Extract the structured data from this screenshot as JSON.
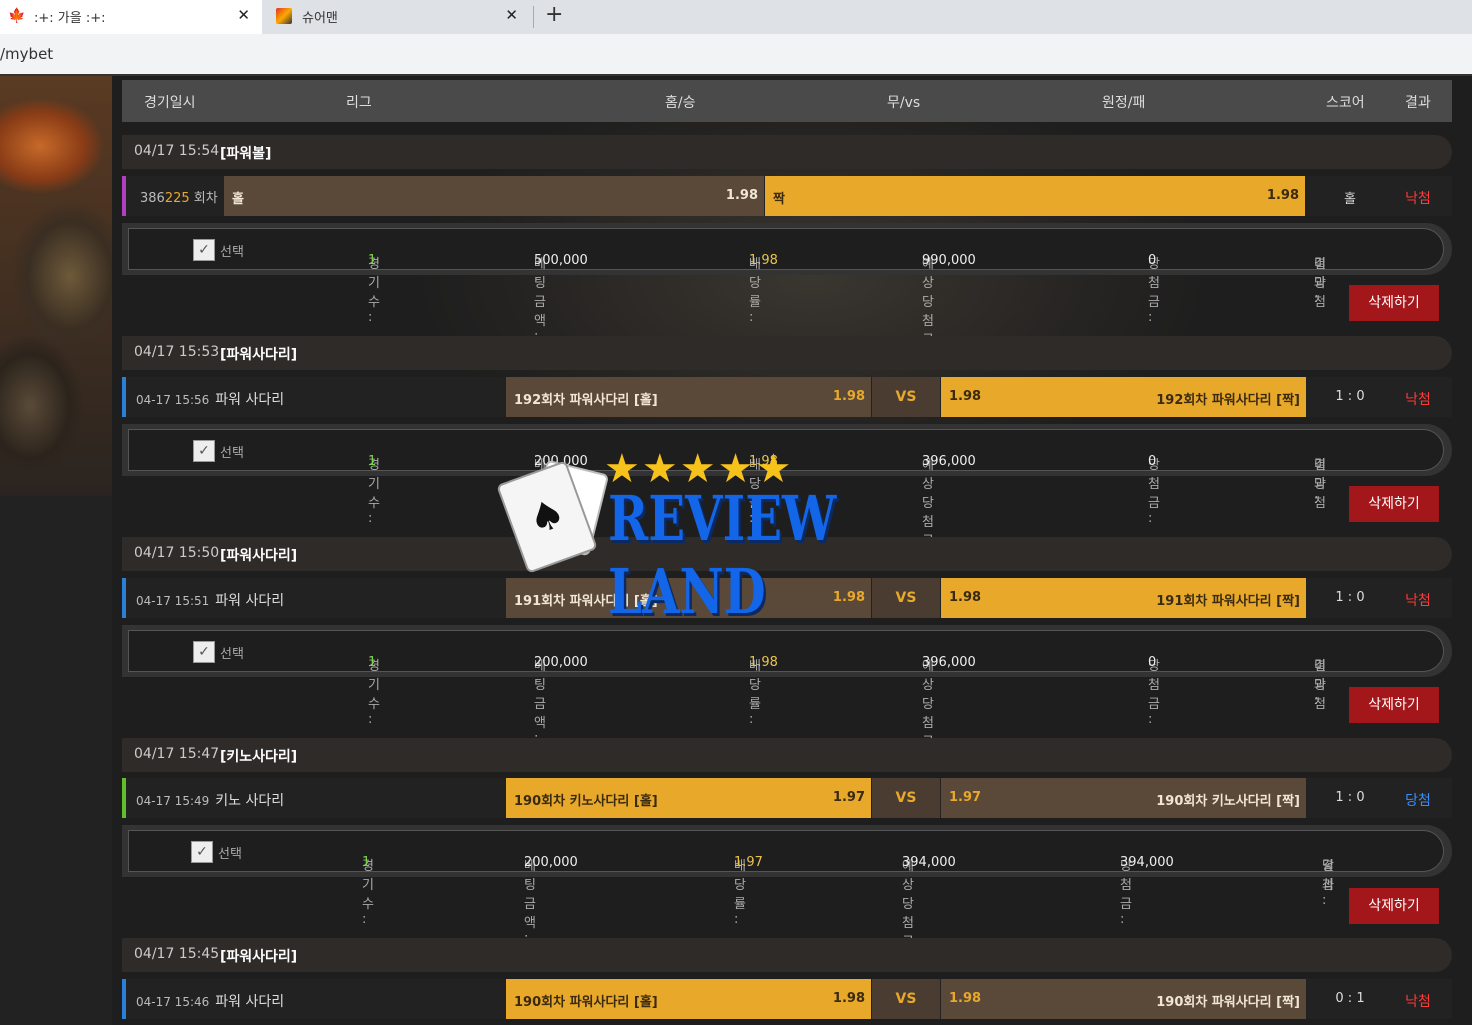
{
  "browser": {
    "tabs": [
      {
        "title": ":+: 가을 :+:",
        "favicon": "maple-leaf-icon"
      },
      {
        "title": "슈어맨",
        "favicon": "site-favicon"
      }
    ],
    "new_tab_label": "+",
    "close_label": "✕",
    "url": "/mybet"
  },
  "header": {
    "date": "경기일시",
    "league": "리그",
    "home": "홈/승",
    "draw": "무/vs",
    "away": "원정/패",
    "score": "스코어",
    "result": "결과"
  },
  "watermark": {
    "text": "REVIEW LAND",
    "stars": "★★★★★"
  },
  "labels": {
    "select": "선택",
    "count": "경기수 : ",
    "bet_amount": "베팅금액 : ",
    "odds": "배당률 : ",
    "expected": "예상당첨금 : ",
    "won": "당첨금 : ",
    "result": "결과 : ",
    "delete": "삭제하기",
    "vs": "VS"
  },
  "bets": [
    {
      "date": "04/17 15:54",
      "league": "[파워볼]",
      "round_prefix": "386",
      "round_num": "225",
      "round_suffix": " 회차",
      "home_label": "홀",
      "home_odds": "1.98",
      "away_label": "짝",
      "away_odds": "1.98",
      "score": "홀",
      "result": "낙첨",
      "count": "1",
      "amount": "500,000",
      "odds": "1.98",
      "expected": "990,000",
      "won": "0",
      "status": "미당첨"
    },
    {
      "date": "04/17 15:53",
      "league": "[파워사다리]",
      "time": "04-17 15:56",
      "lname": "파워 사다리",
      "home_label": "192회차 파워사다리 [홀]",
      "home_odds": "1.98",
      "away_label": "192회차 파워사다리 [짝]",
      "away_odds": "1.98",
      "score": "1 : 0",
      "result": "낙첨",
      "count": "1",
      "amount": "200,000",
      "odds": "1.98",
      "expected": "396,000",
      "won": "0",
      "status": "미당첨"
    },
    {
      "date": "04/17 15:50",
      "league": "[파워사다리]",
      "time": "04-17 15:51",
      "lname": "파워 사다리",
      "home_label": "191회차 파워사다리 [홀]",
      "home_odds": "1.98",
      "away_label": "191회차 파워사다리 [짝]",
      "away_odds": "1.98",
      "score": "1 : 0",
      "result": "낙첨",
      "count": "1",
      "amount": "200,000",
      "odds": "1.98",
      "expected": "396,000",
      "won": "0",
      "status": "미당첨"
    },
    {
      "date": "04/17 15:47",
      "league": "[키노사다리]",
      "time": "04-17 15:49",
      "lname": "키노 사다리",
      "home_label": "190회차 키노사다리 [홀]",
      "home_odds": "1.97",
      "away_label": "190회차 키노사다리 [짝]",
      "away_odds": "1.97",
      "score": "1 : 0",
      "result": "당첨",
      "count": "1",
      "amount": "200,000",
      "odds": "1.97",
      "expected": "394,000",
      "won": "394,000",
      "status": "당첨"
    },
    {
      "date": "04/17 15:45",
      "league": "[파워사다리]",
      "time": "04-17 15:46",
      "lname": "파워 사다리",
      "home_label": "190회차 파워사다리 [홀]",
      "home_odds": "1.98",
      "away_label": "190회차 파워사다리 [짝]",
      "away_odds": "1.98",
      "score": "0 : 1",
      "result": "낙첨"
    }
  ],
  "colors": {
    "accent_gold": "#e8a92b",
    "pick_brown": "#5a4838",
    "lose_red": "#ff3b3b",
    "win_blue": "#3b8cff",
    "delete_red": "#a3161a"
  }
}
